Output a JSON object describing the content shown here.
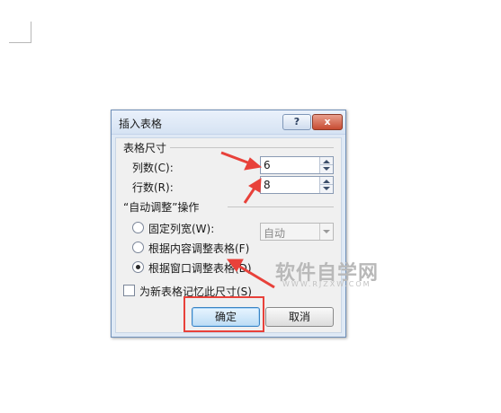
{
  "dialog": {
    "title": "插入表格",
    "help_label": "?",
    "close_label": "x",
    "table_size_label": "表格尺寸",
    "columns_label": "列数(C):",
    "columns_value": "6",
    "rows_label": "行数(R):",
    "rows_value": "8",
    "autofit_label": "“自动调整”操作",
    "options": [
      {
        "label": "固定列宽(W):",
        "selected": false
      },
      {
        "label": "根据内容调整表格(F)",
        "selected": false
      },
      {
        "label": "根据窗口调整表格(D)",
        "selected": true
      }
    ],
    "fixed_width_value": "自动",
    "remember_label": "为新表格记忆此尺寸(S)",
    "ok_label": "确定",
    "cancel_label": "取消"
  },
  "watermark": {
    "text": "软件自学网",
    "sub": "WWW.RJZXW.COM"
  },
  "annotation_color": "#e8413a"
}
